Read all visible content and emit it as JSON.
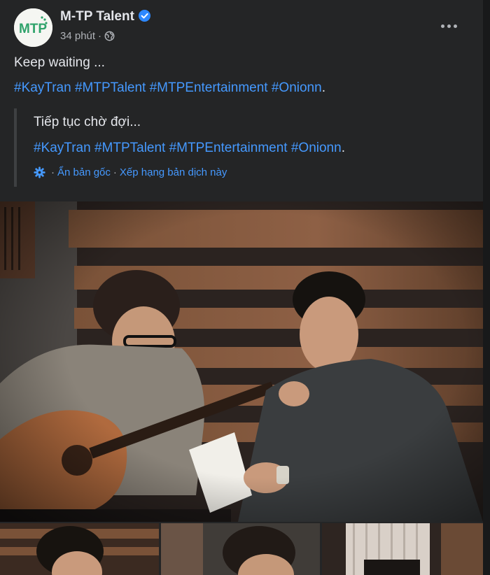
{
  "post": {
    "page_name": "M-TP Talent",
    "logo_text": "MTP",
    "time": "34 phút",
    "dot": "·",
    "caption": "Keep waiting ...",
    "hashtags": [
      "#KayTran",
      "#MTPTalent",
      "#MTPEntertainment",
      "#Onionn"
    ],
    "end_period": "."
  },
  "translation": {
    "text": "Tiếp tục chờ đợi...",
    "hashtags": [
      "#KayTran",
      "#MTPTalent",
      "#MTPEntertainment",
      "#Onionn"
    ],
    "end_period": ".",
    "prefix_dot": "·",
    "hide_original": "Ẩn bản gốc",
    "separator": "·",
    "rate_translation": "Xếp hạng bản dịch này"
  },
  "icons": {
    "verified": "verified-badge-icon",
    "audience": "globe-icon",
    "more": "more-options-icon",
    "settings": "gear-icon"
  },
  "colors": {
    "background": "#242526",
    "link": "#4599ff",
    "text_primary": "#e4e6eb",
    "text_secondary": "#b0b3b8",
    "verified": "#2d88ff",
    "logo_green": "#2fa36b"
  }
}
